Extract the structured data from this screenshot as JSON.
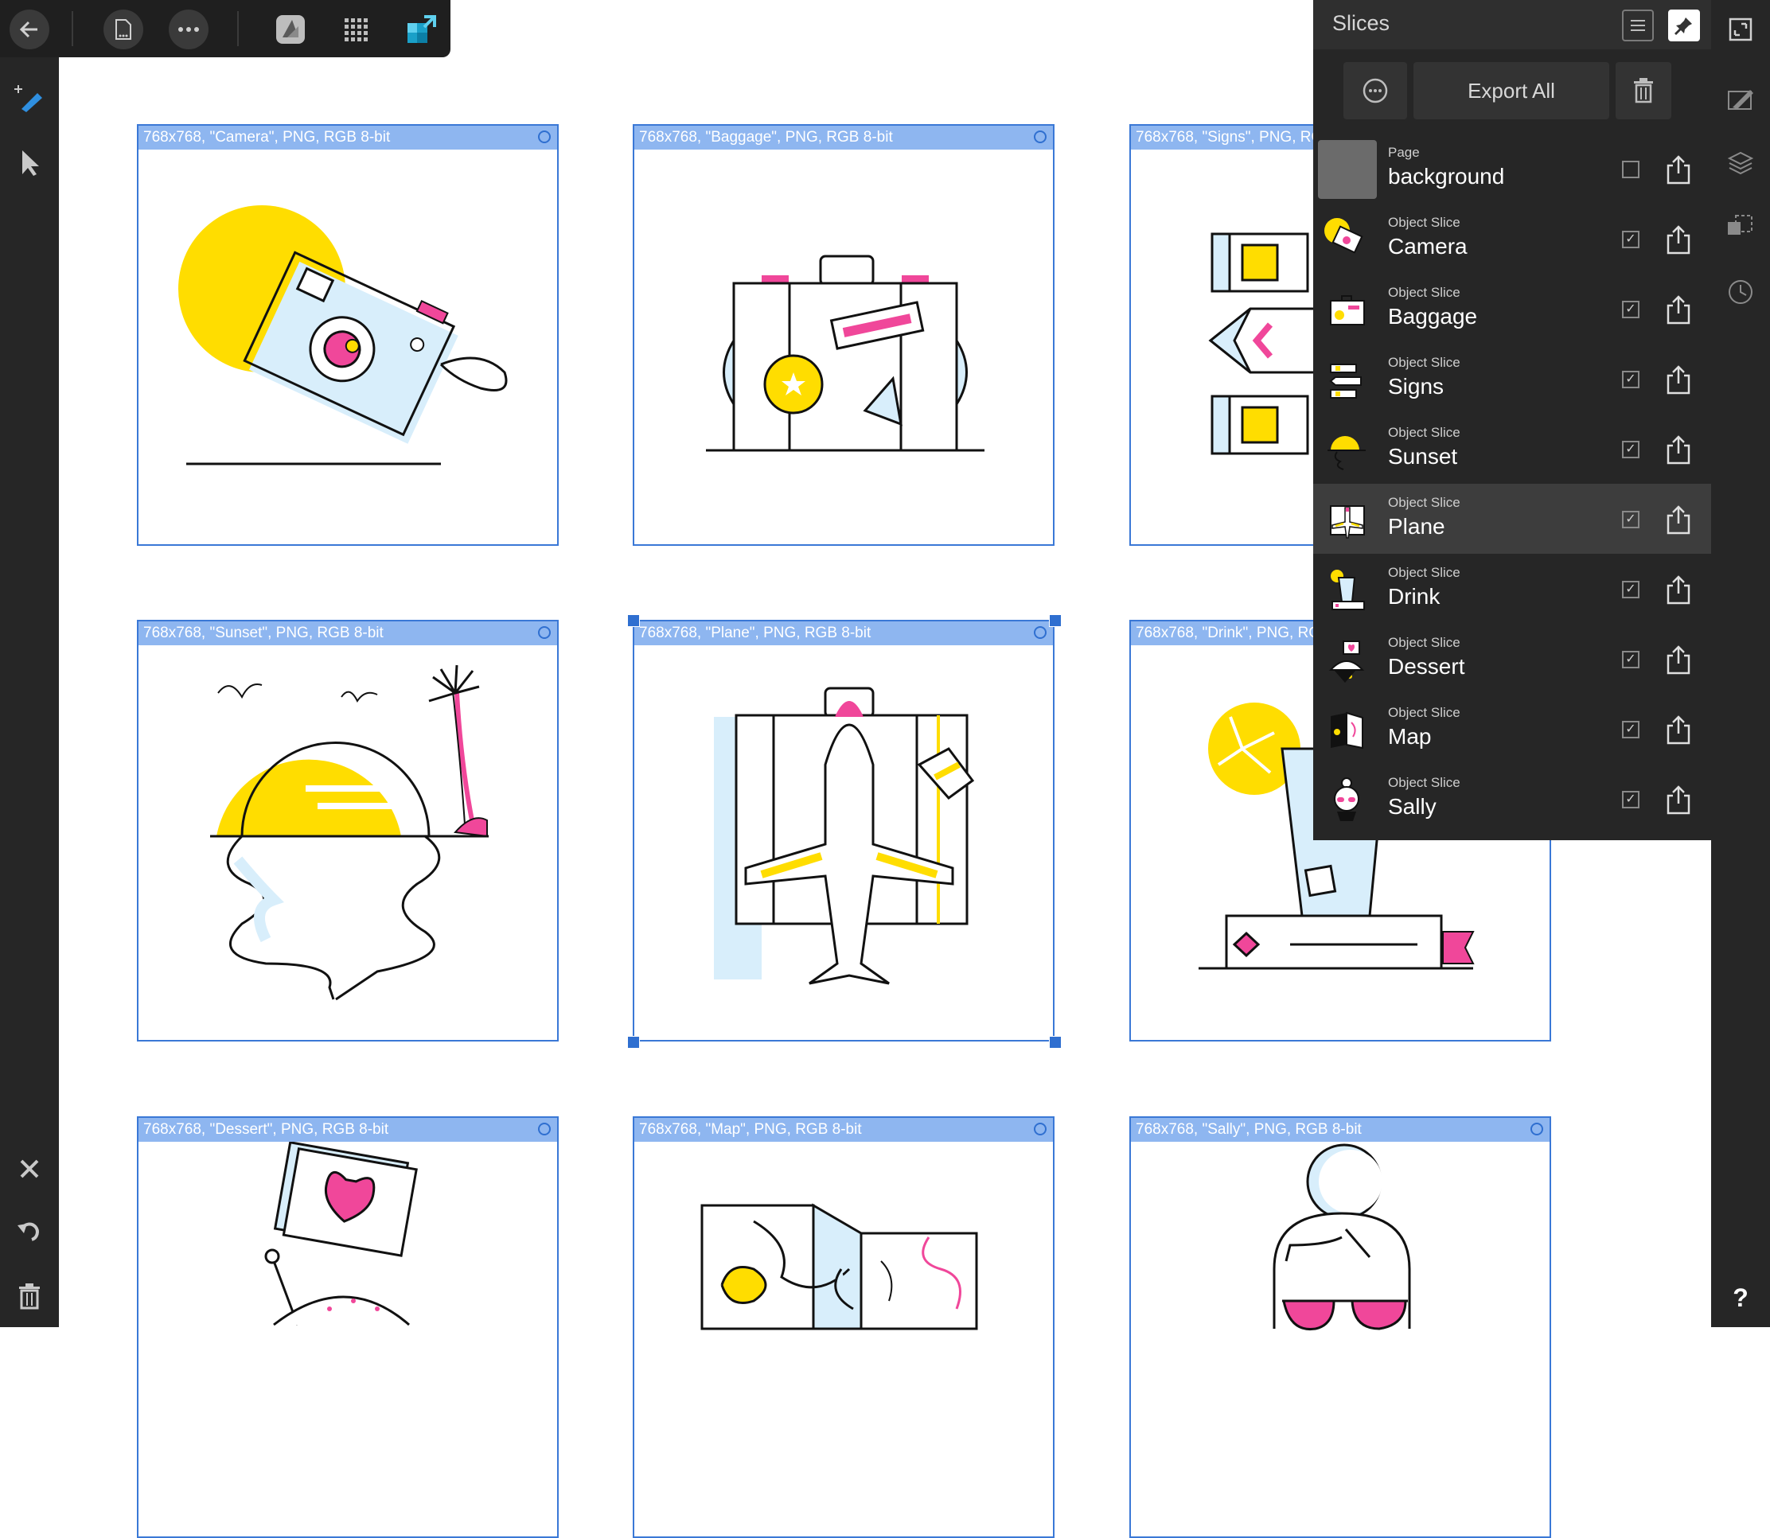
{
  "panel": {
    "title": "Slices",
    "export_all_label": "Export All",
    "rows": [
      {
        "type": "Page",
        "name": "background",
        "checked": false
      },
      {
        "type": "Object Slice",
        "name": "Camera",
        "checked": true
      },
      {
        "type": "Object Slice",
        "name": "Baggage",
        "checked": true
      },
      {
        "type": "Object Slice",
        "name": "Signs",
        "checked": true
      },
      {
        "type": "Object Slice",
        "name": "Sunset",
        "checked": true
      },
      {
        "type": "Object Slice",
        "name": "Plane",
        "checked": true,
        "selected": true
      },
      {
        "type": "Object Slice",
        "name": "Drink",
        "checked": true
      },
      {
        "type": "Object Slice",
        "name": "Dessert",
        "checked": true
      },
      {
        "type": "Object Slice",
        "name": "Map",
        "checked": true
      },
      {
        "type": "Object Slice",
        "name": "Sally",
        "checked": true
      }
    ],
    "check_glyph": "✓"
  },
  "canvas": {
    "slices": [
      {
        "label": "768x768, \"Camera\", PNG, RGB 8-bit"
      },
      {
        "label": "768x768, \"Baggage\", PNG, RGB 8-bit"
      },
      {
        "label": "768x768, \"Signs\", PNG, RGB 8-bit"
      },
      {
        "label": "768x768, \"Sunset\", PNG, RGB 8-bit"
      },
      {
        "label": "768x768, \"Plane\", PNG, RGB 8-bit"
      },
      {
        "label": "768x768, \"Drink\", PNG, RGB 8-bit"
      },
      {
        "label": "768x768, \"Dessert\", PNG, RGB 8-bit"
      },
      {
        "label": "768x768, \"Map\", PNG, RGB 8-bit"
      },
      {
        "label": "768x768, \"Sally\", PNG, RGB 8-bit"
      }
    ]
  },
  "right_bar": {
    "help_label": "?"
  },
  "colors": {
    "accent": "#2f6fd0",
    "yellow": "#ffdd00",
    "pink": "#f0479a",
    "lightblue": "#d8eefb"
  },
  "icons": {
    "back": "back-arrow-icon",
    "document": "document-icon",
    "more": "more-icon",
    "designer": "designer-persona-icon",
    "pixel": "pixel-persona-icon",
    "export": "export-persona-icon",
    "slice_tool": "slice-tool-icon",
    "select": "select-tool-icon",
    "close": "close-icon",
    "undo": "undo-icon",
    "trash": "trash-icon"
  }
}
